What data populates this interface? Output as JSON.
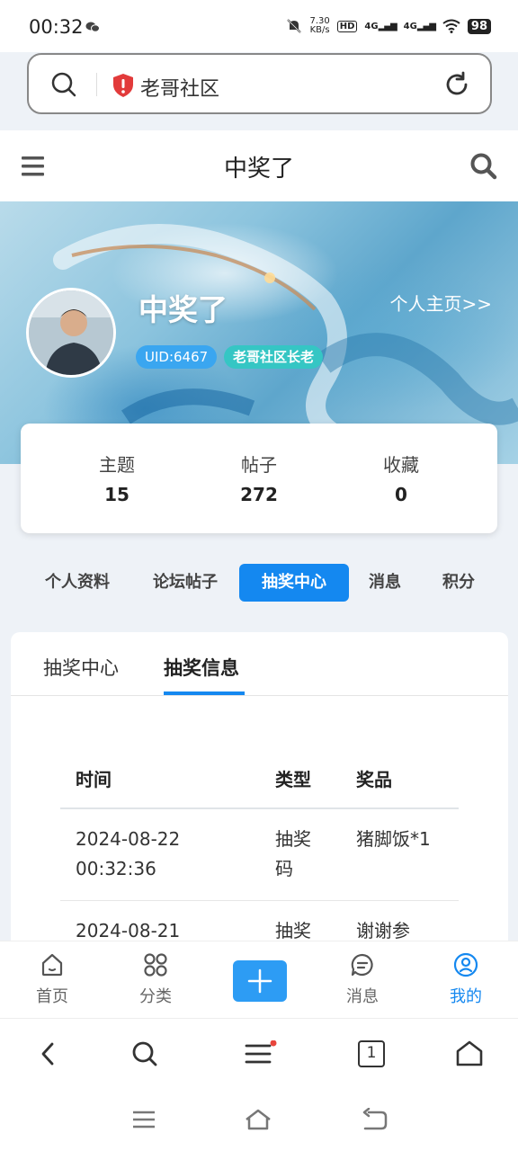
{
  "status_bar": {
    "time": "00:32",
    "net_speed_value": "7.30",
    "net_speed_unit": "KB/s",
    "hd_label": "HD",
    "signal_1": "4G",
    "signal_2": "4G",
    "battery": "98"
  },
  "address_bar": {
    "site_name": "老哥社区"
  },
  "header": {
    "title": "中奖了"
  },
  "profile": {
    "username": "中奖了",
    "profile_link": "个人主页>>",
    "uid": "UID:6467",
    "rank": "老哥社区长老"
  },
  "stats": [
    {
      "label": "主题",
      "value": "15"
    },
    {
      "label": "帖子",
      "value": "272"
    },
    {
      "label": "收藏",
      "value": "0"
    }
  ],
  "profile_tabs": [
    {
      "label": "个人资料",
      "active": false
    },
    {
      "label": "论坛帖子",
      "active": false
    },
    {
      "label": "抽奖中心",
      "active": true
    },
    {
      "label": "消息",
      "active": false
    },
    {
      "label": "积分",
      "active": false
    }
  ],
  "lottery_tabs": [
    {
      "label": "抽奖中心",
      "active": false
    },
    {
      "label": "抽奖信息",
      "active": true
    }
  ],
  "table": {
    "headers": [
      "时间",
      "类型",
      "奖品"
    ],
    "rows": [
      {
        "date": "2024-08-22",
        "time": "00:32:36",
        "type_line1": "抽奖",
        "type_line2": "码",
        "prize": "猪脚饭*1"
      },
      {
        "date": "2024-08-21",
        "time": "",
        "type_line1": "抽奖",
        "type_line2": "",
        "prize": "谢谢参"
      }
    ]
  },
  "app_nav": [
    {
      "label": "首页",
      "icon": "home-icon",
      "active": false
    },
    {
      "label": "分类",
      "icon": "grid-icon",
      "active": false
    },
    {
      "label": "",
      "icon": "plus-icon",
      "active": false
    },
    {
      "label": "消息",
      "icon": "message-icon",
      "active": false
    },
    {
      "label": "我的",
      "icon": "user-icon",
      "active": true
    }
  ],
  "browser_toolbar": {
    "tab_count": "1"
  },
  "colors": {
    "accent": "#1488f0",
    "uid_badge": "#3aa6f0",
    "rank_badge": "#35c6c4",
    "shield": "#e23b3b"
  }
}
